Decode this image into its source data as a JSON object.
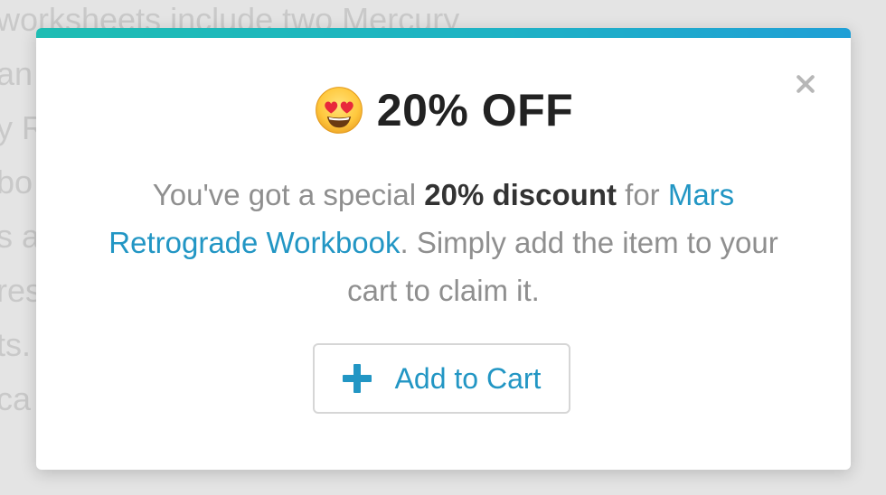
{
  "background": {
    "lines": [
      "worksheets include two Mercury",
      "an",
      "y R",
      "bo",
      "s a",
      "res",
      "ts.",
      "ca"
    ]
  },
  "modal": {
    "title": "20% OFF",
    "title_emoji": "heart-eyes-emoji",
    "message": {
      "part1": "You've got a special ",
      "bold": "20% discount",
      "part2": " for ",
      "product_link": "Mars Retrograde Workbook",
      "part3": ". Simply add the item to your cart to claim it."
    },
    "add_to_cart_label": "Add to Cart",
    "close_icon": "close-icon",
    "plus_icon": "plus-icon"
  },
  "colors": {
    "accent_start": "#1ebdb3",
    "accent_end": "#1f9fd6",
    "link": "#2296c4",
    "title": "#222222",
    "body": "#8f8f8f"
  }
}
